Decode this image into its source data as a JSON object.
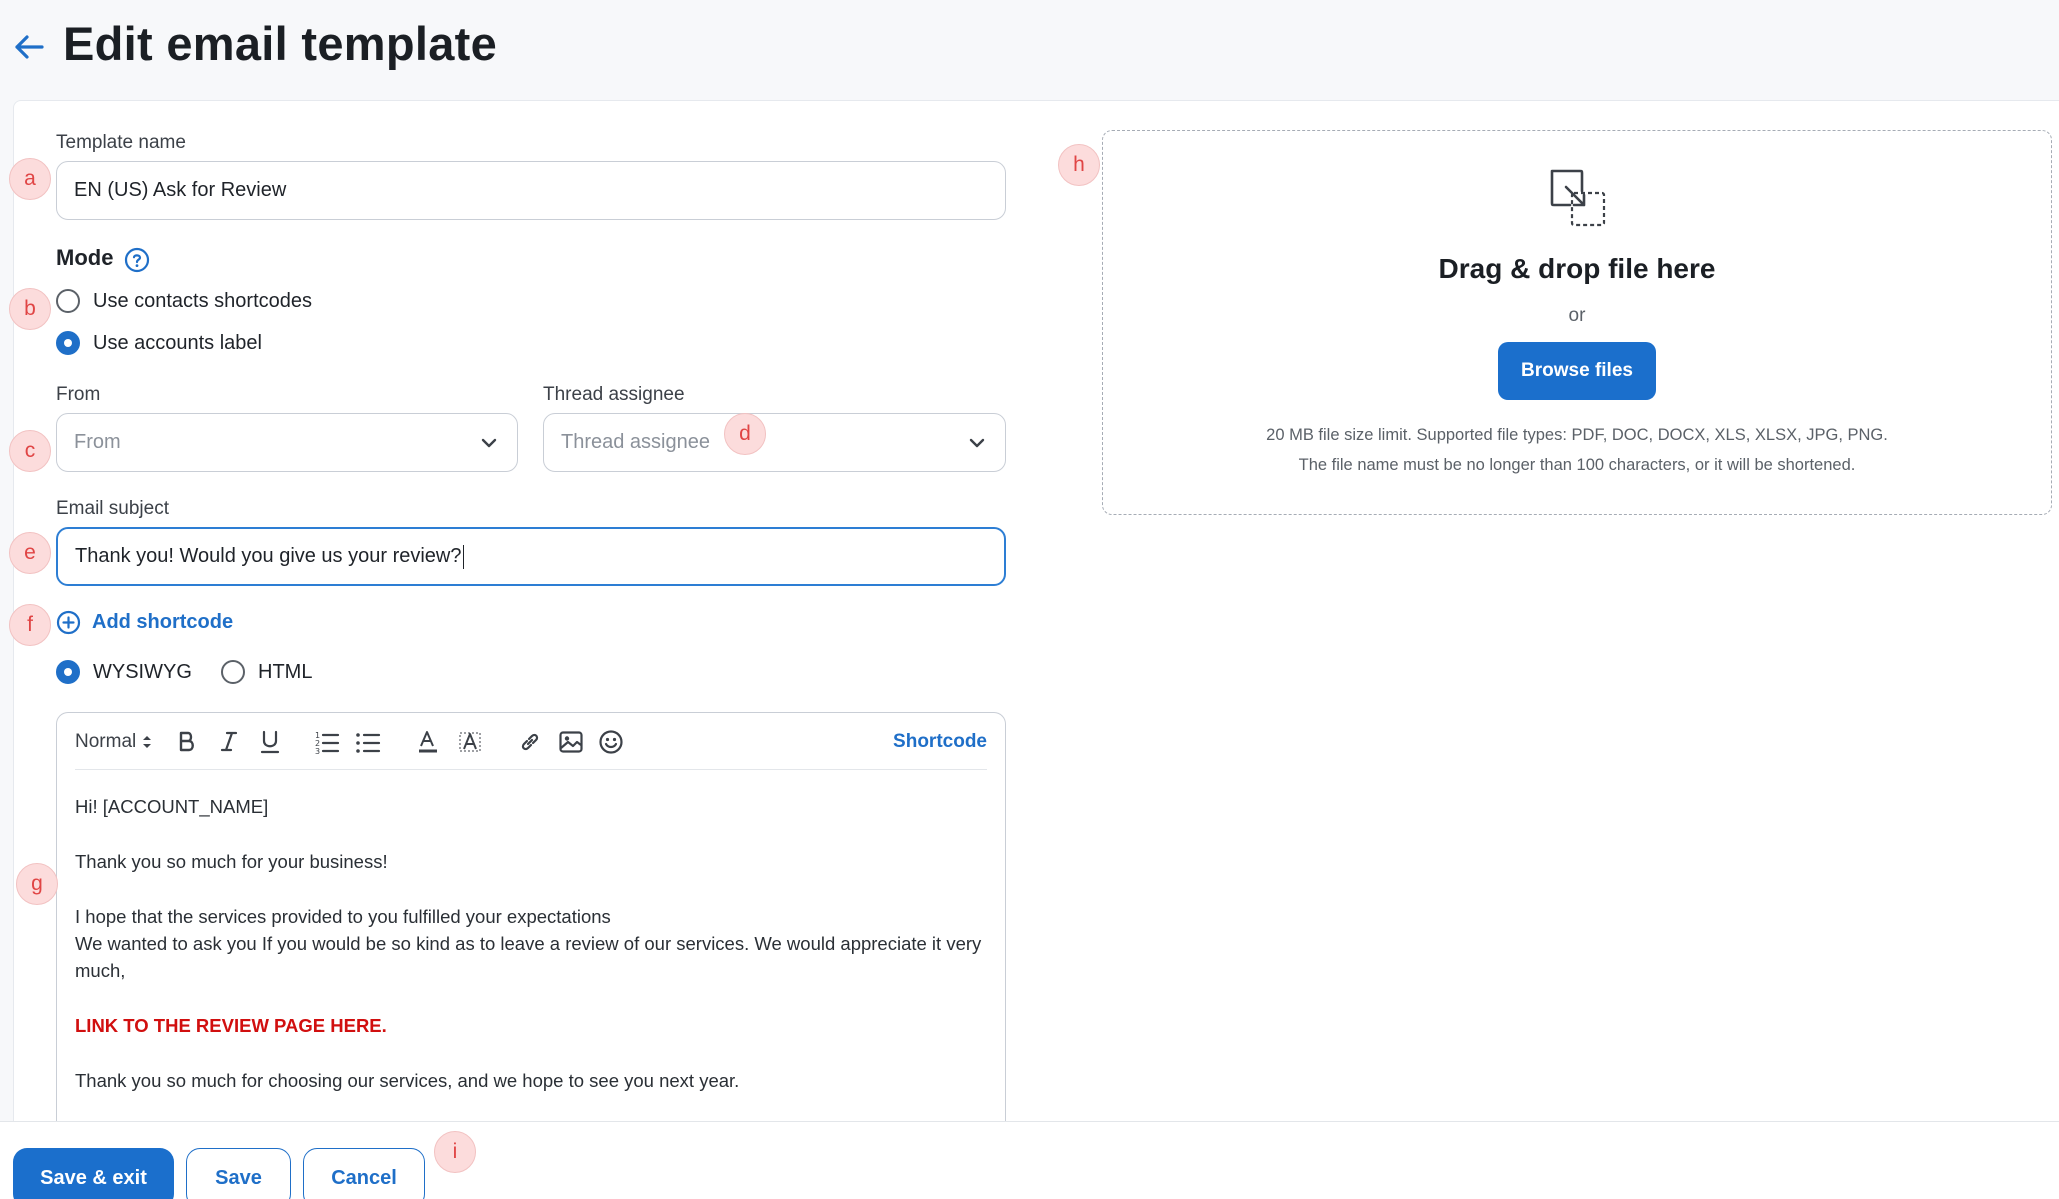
{
  "header": {
    "title": "Edit email template"
  },
  "form": {
    "template_name": {
      "label": "Template name",
      "value": "EN (US) Ask for Review"
    },
    "mode": {
      "title": "Mode",
      "options": [
        {
          "label": "Use contacts shortcodes",
          "checked": false
        },
        {
          "label": "Use accounts label",
          "checked": true
        }
      ]
    },
    "from": {
      "label": "From",
      "placeholder": "From"
    },
    "thread_assignee": {
      "label": "Thread assignee",
      "placeholder": "Thread assignee"
    },
    "email_subject": {
      "label": "Email subject",
      "value": "Thank you! Would you give us your review?"
    },
    "add_shortcode": "Add shortcode",
    "format_options": [
      {
        "label": "WYSIWYG",
        "checked": true
      },
      {
        "label": "HTML",
        "checked": false
      }
    ]
  },
  "editor": {
    "toolbar": {
      "style": "Normal",
      "shortcode": "Shortcode"
    },
    "body": {
      "line1": "Hi! [ACCOUNT_NAME]",
      "line2": "Thank you so much for your business!",
      "line3": "I hope that the services provided to you fulfilled your expectations",
      "line4": "We wanted to ask you If you would be so kind as to leave a review of our services. We would appreciate it very much,",
      "link": "LINK TO THE REVIEW PAGE HERE.",
      "line5": "Thank you so much for choosing our services, and we hope to see you next year."
    },
    "link_color": "#d10f0f"
  },
  "upload": {
    "title": "Drag & drop file here",
    "or": "or",
    "button": "Browse files",
    "hint1": "20 MB file size limit. Supported file types: PDF, DOC, DOCX, XLS, XLSX, JPG, PNG.",
    "hint2": "The file name must be no longer than 100 characters, or it will be shortened."
  },
  "footer": {
    "save_exit": "Save & exit",
    "save": "Save",
    "cancel": "Cancel"
  },
  "markers": {
    "a": "a",
    "b": "b",
    "c": "c",
    "d": "d",
    "e": "e",
    "f": "f",
    "g": "g",
    "h": "h",
    "i": "i"
  },
  "colors": {
    "accent": "#1b6fcc",
    "marker_bg": "#fcdcdc",
    "marker_text": "#e04545"
  }
}
